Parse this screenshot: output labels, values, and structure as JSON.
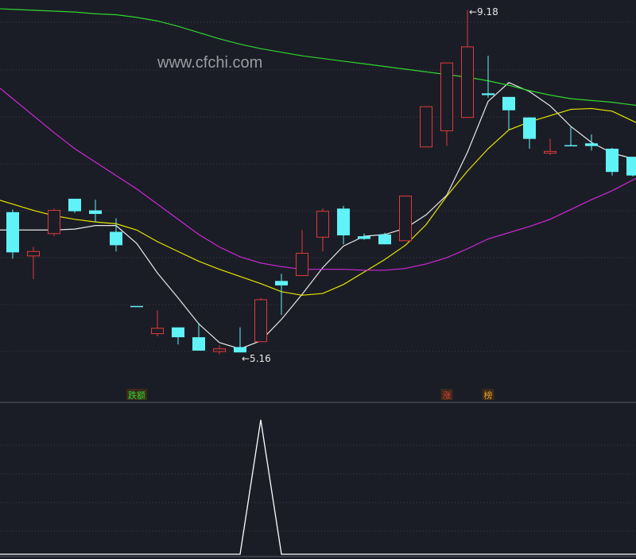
{
  "watermark": "www.cfchi.com",
  "colors": {
    "background": "#1b1d26",
    "up": "#e03a3a",
    "down": "#5ff3f8",
    "ma_white": "#e8e8e8",
    "ma_yellow": "#e6e600",
    "ma_magenta": "#d028d8",
    "ma_green": "#2ed62e",
    "grid": "#3a3d4a",
    "divider": "#5a5d6a",
    "indicator": "#ffffff"
  },
  "chart_data": [
    {
      "type": "candlestick",
      "title": "",
      "annotations": [
        {
          "label": "9.18",
          "candle_index": 22
        },
        {
          "label": "5.16",
          "candle_index": 11
        }
      ],
      "ylim": [
        4.8,
        9.25
      ],
      "grid": true,
      "candles": [
        {
          "o": 6.92,
          "h": 6.95,
          "l": 6.4,
          "c": 6.47,
          "dir": "down"
        },
        {
          "o": 6.48,
          "h": 6.53,
          "l": 6.17,
          "c": 6.43,
          "dir": "up"
        },
        {
          "o": 6.68,
          "h": 6.96,
          "l": 6.65,
          "c": 6.94,
          "dir": "up"
        },
        {
          "o": 7.07,
          "h": 7.07,
          "l": 6.91,
          "c": 6.93,
          "dir": "down"
        },
        {
          "o": 6.94,
          "h": 7.06,
          "l": 6.81,
          "c": 6.9,
          "dir": "down"
        },
        {
          "o": 6.7,
          "h": 6.85,
          "l": 6.48,
          "c": 6.55,
          "dir": "down"
        },
        {
          "o": 5.87,
          "h": 5.87,
          "l": 5.87,
          "c": 5.87,
          "dir": "down"
        },
        {
          "o": 5.56,
          "h": 5.82,
          "l": 5.53,
          "c": 5.62,
          "dir": "up"
        },
        {
          "o": 5.63,
          "h": 5.63,
          "l": 5.44,
          "c": 5.52,
          "dir": "down"
        },
        {
          "o": 5.52,
          "h": 5.68,
          "l": 5.37,
          "c": 5.37,
          "dir": "down"
        },
        {
          "o": 5.36,
          "h": 5.43,
          "l": 5.33,
          "c": 5.39,
          "dir": "up"
        },
        {
          "o": 5.41,
          "h": 5.63,
          "l": 5.38,
          "c": 5.35,
          "dir": "down"
        },
        {
          "o": 5.47,
          "h": 5.96,
          "l": 5.47,
          "c": 5.94,
          "dir": "up"
        },
        {
          "o": 6.15,
          "h": 6.23,
          "l": 5.77,
          "c": 6.1,
          "dir": "down"
        },
        {
          "o": 6.21,
          "h": 6.72,
          "l": 6.21,
          "c": 6.46,
          "dir": "up"
        },
        {
          "o": 6.64,
          "h": 6.96,
          "l": 6.48,
          "c": 6.93,
          "dir": "up"
        },
        {
          "o": 6.96,
          "h": 6.99,
          "l": 6.56,
          "c": 6.66,
          "dir": "down"
        },
        {
          "o": 6.65,
          "h": 6.68,
          "l": 6.61,
          "c": 6.62,
          "dir": "down"
        },
        {
          "o": 6.67,
          "h": 6.69,
          "l": 6.56,
          "c": 6.56,
          "dir": "down"
        },
        {
          "o": 6.6,
          "h": 7.1,
          "l": 6.6,
          "c": 7.1,
          "dir": "up"
        },
        {
          "o": 7.65,
          "h": 8.1,
          "l": 7.65,
          "c": 8.1,
          "dir": "up"
        },
        {
          "o": 7.83,
          "h": 8.59,
          "l": 7.66,
          "c": 8.59,
          "dir": "up"
        },
        {
          "o": 7.98,
          "h": 9.18,
          "l": 7.98,
          "c": 8.77,
          "dir": "up"
        },
        {
          "o": 8.25,
          "h": 8.67,
          "l": 8.2,
          "c": 8.23,
          "dir": "down"
        },
        {
          "o": 8.21,
          "h": 8.18,
          "l": 7.84,
          "c": 8.06,
          "dir": "down"
        },
        {
          "o": 7.98,
          "h": 7.98,
          "l": 7.63,
          "c": 7.74,
          "dir": "down"
        },
        {
          "o": 7.6,
          "h": 7.74,
          "l": 7.56,
          "c": 7.58,
          "dir": "up"
        },
        {
          "o": 7.67,
          "h": 7.88,
          "l": 7.66,
          "c": 7.67,
          "dir": "down"
        },
        {
          "o": 7.69,
          "h": 7.79,
          "l": 7.61,
          "c": 7.66,
          "dir": "down"
        },
        {
          "o": 7.63,
          "h": 7.64,
          "l": 7.33,
          "c": 7.37,
          "dir": "down"
        },
        {
          "o": 7.54,
          "h": 7.54,
          "l": 7.32,
          "c": 7.33,
          "dir": "down"
        }
      ],
      "moving_averages": [
        {
          "color": "#e8e8e8",
          "values": [
            6.72,
            6.72,
            6.72,
            6.73,
            6.77,
            6.77,
            6.57,
            6.24,
            5.96,
            5.67,
            5.46,
            5.39,
            5.48,
            5.72,
            6.0,
            6.3,
            6.54,
            6.65,
            6.67,
            6.74,
            6.89,
            7.11,
            7.59,
            8.16,
            8.37,
            8.27,
            8.11,
            7.88,
            7.7,
            7.58,
            7.52
          ]
        },
        {
          "color": "#e6e600",
          "values": [
            7.01,
            6.94,
            6.88,
            6.84,
            6.81,
            6.79,
            6.72,
            6.59,
            6.48,
            6.37,
            6.28,
            6.2,
            6.12,
            6.03,
            5.99,
            6.01,
            6.11,
            6.25,
            6.39,
            6.55,
            6.78,
            7.1,
            7.38,
            7.63,
            7.84,
            7.93,
            8.0,
            8.07,
            8.08,
            8.05,
            7.94
          ]
        },
        {
          "color": "#d028d8",
          "values": [
            8.19,
            8.0,
            7.81,
            7.63,
            7.48,
            7.33,
            7.18,
            7.01,
            6.84,
            6.67,
            6.53,
            6.42,
            6.35,
            6.31,
            6.28,
            6.28,
            6.28,
            6.27,
            6.27,
            6.29,
            6.34,
            6.41,
            6.51,
            6.62,
            6.69,
            6.76,
            6.84,
            6.95,
            7.06,
            7.16,
            7.28
          ]
        },
        {
          "color": "#2ed62e",
          "values": [
            9.19,
            9.18,
            9.17,
            9.16,
            9.14,
            9.13,
            9.1,
            9.06,
            9.0,
            8.93,
            8.86,
            8.8,
            8.75,
            8.71,
            8.67,
            8.64,
            8.61,
            8.58,
            8.55,
            8.52,
            8.49,
            8.46,
            8.43,
            8.39,
            8.34,
            8.28,
            8.23,
            8.19,
            8.17,
            8.15,
            8.12
          ]
        }
      ],
      "markers": [
        {
          "text": "跌额",
          "candle_index": 6,
          "color": "#2ed62e"
        },
        {
          "text": "涨",
          "candle_index": 21,
          "color": "#e03a3a"
        },
        {
          "text": "榜",
          "candle_index": 23,
          "color": "#e6a12a"
        }
      ]
    },
    {
      "type": "line",
      "title": "",
      "ylim": [
        0,
        1
      ],
      "grid": true,
      "series": [
        {
          "color": "#ffffff",
          "values": [
            0,
            0,
            0,
            0,
            0,
            0,
            0,
            0,
            0,
            0,
            0,
            0,
            1,
            0,
            0,
            0,
            0,
            0,
            0,
            0,
            0,
            0,
            0,
            0,
            0,
            0,
            0,
            0,
            0,
            0,
            0
          ]
        }
      ]
    }
  ]
}
